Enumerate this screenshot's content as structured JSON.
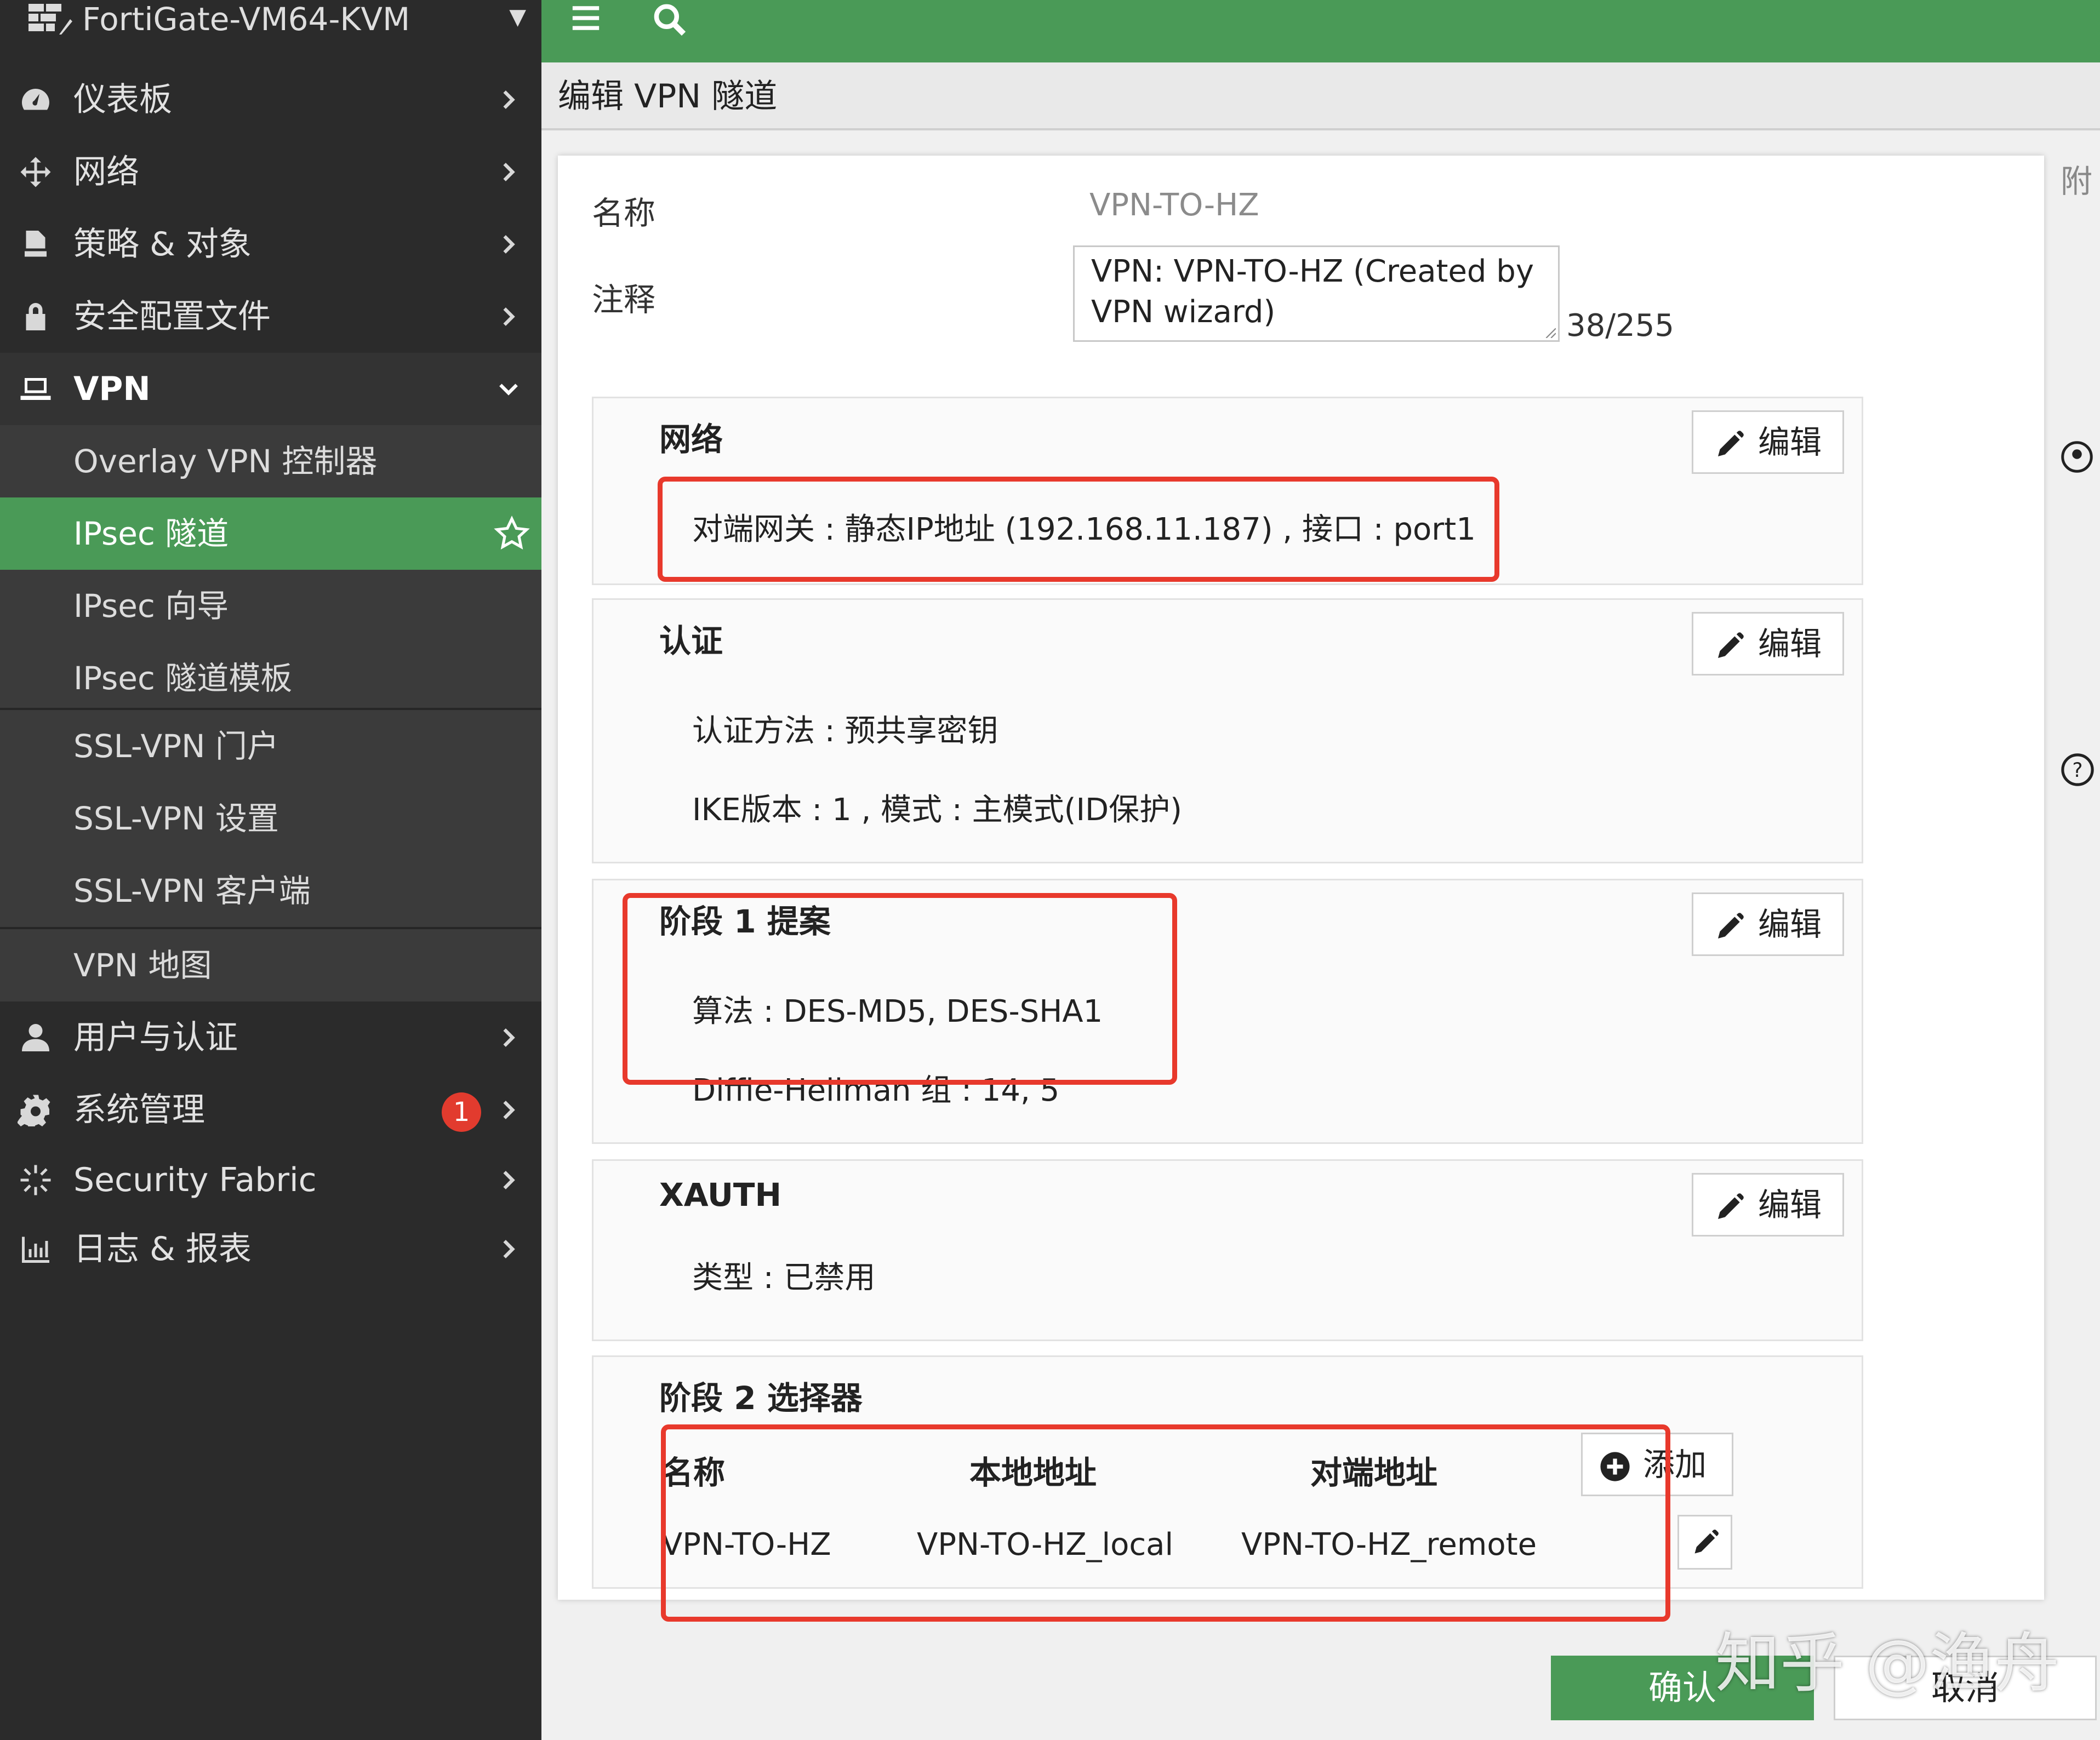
{
  "app": {
    "device_name": "FortiGate-VM64-KVM"
  },
  "sidebar": {
    "items": [
      {
        "label": "仪表板",
        "icon": "dashboard-icon"
      },
      {
        "label": "网络",
        "icon": "network-move-icon"
      },
      {
        "label": "策略 & 对象",
        "icon": "policy-icon"
      },
      {
        "label": "安全配置文件",
        "icon": "lock-icon"
      },
      {
        "label": "VPN",
        "icon": "laptop-icon"
      }
    ],
    "vpn_sub": [
      {
        "label": "Overlay VPN 控制器"
      },
      {
        "label": "IPsec 隧道"
      },
      {
        "label": "IPsec 向导"
      },
      {
        "label": "IPsec 隧道模板"
      },
      {
        "label": "SSL-VPN 门户"
      },
      {
        "label": "SSL-VPN 设置"
      },
      {
        "label": "SSL-VPN 客户端"
      },
      {
        "label": "VPN 地图"
      }
    ],
    "items_bottom": [
      {
        "label": "用户与认证",
        "icon": "user-icon"
      },
      {
        "label": "系统管理",
        "icon": "gear-icon",
        "badge": "1"
      },
      {
        "label": "Security Fabric",
        "icon": "fabric-icon"
      },
      {
        "label": "日志 & 报表",
        "icon": "chart-bars-icon"
      }
    ]
  },
  "header": {
    "title": "编辑 VPN 隧道"
  },
  "form": {
    "name_label": "名称",
    "name_value": "VPN-TO-HZ",
    "comment_label": "注释",
    "comment_line1": "VPN: VPN-TO-HZ (Created by",
    "comment_line2": "VPN wizard)",
    "comment_count": "38/255"
  },
  "edit_label": "编辑",
  "cards": {
    "network": {
      "title": "网络",
      "line1": "对端网关 : 静态IP地址 (192.168.11.187) , 接口 : port1"
    },
    "auth": {
      "title": "认证",
      "line1": "认证方法 : 预共享密钥",
      "line2": "IKE版本 : 1 , 模式 : 主模式(ID保护)"
    },
    "phase1": {
      "title": "阶段 1 提案",
      "line1": "算法 : DES-MD5, DES-SHA1",
      "line2": "Diffie-Hellman 组 : 14, 5"
    },
    "xauth": {
      "title": "XAUTH",
      "line1": "类型 : 已禁用"
    },
    "phase2": {
      "title": "阶段 2 选择器",
      "columns": [
        "名称",
        "本地地址",
        "对端地址"
      ],
      "rows": [
        {
          "name": "VPN-TO-HZ",
          "local": "VPN-TO-HZ_local",
          "remote": "VPN-TO-HZ_remote"
        }
      ],
      "add_label": "添加"
    }
  },
  "side_panel": {
    "title_fragment": "附"
  },
  "footer": {
    "ok_label": "确认",
    "cancel_label": "取消"
  },
  "watermark": "知乎 @渔舟",
  "colors": {
    "accent_green": "#4a9a57",
    "sidebar_bg": "#2b2b2b",
    "highlight_red": "#e8392c",
    "badge_red": "#e23b2e"
  }
}
